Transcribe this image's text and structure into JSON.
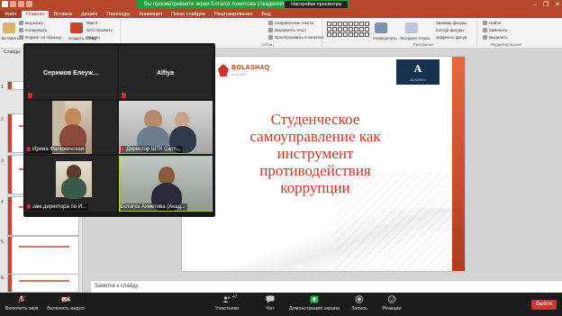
{
  "titlebar": {
    "zoom_banner": "Вы просматриваете экран Ботагоз Ахметова (Академия \"Bo...",
    "view_options": "Настройки просмотра",
    "minimize": "–",
    "maximize": "❐",
    "close": "✕"
  },
  "ribbon": {
    "tabs": [
      "Файл",
      "Главная",
      "Вставка",
      "Дизайн",
      "Переходы",
      "Анимация",
      "Показ слайдов",
      "Рецензирование",
      "Вид"
    ],
    "clipboard": {
      "cut": "Вырезать",
      "copy": "Копировать",
      "format": "Формат по образцу",
      "paste": "Вставить"
    },
    "slides": {
      "create": "Создать слайд",
      "layout": "Макет",
      "reset": "Восстановить",
      "section": "Раздел"
    },
    "paragraph": {
      "text_direction": "Направление текста",
      "align_text": "Выровнять текст",
      "smartart": "Преобразовать в SmartArt",
      "group_label": "Абзац"
    },
    "drawing": {
      "arrange": "Упорядочить",
      "quick_styles": "Экспресс-стили",
      "fill": "Заливка фигуры",
      "outline": "Контур фигуры",
      "effects": "Эффекты фигур",
      "group_label": "Рисование"
    },
    "editing": {
      "find": "Найти",
      "replace": "Заменить",
      "select": "Выделить",
      "group_label": "Редактирование"
    }
  },
  "slide_panel": {
    "header": "Слайды",
    "numbers": [
      "1",
      "2",
      "3",
      "4",
      "5",
      "6"
    ]
  },
  "slide": {
    "logo_left_name": "BOLASHAQ",
    "logo_left_sub": "ACADEMY",
    "logo_right_letter": "A",
    "logo_right_sub": "ACADEMY",
    "title": "Студенческое самоуправление как инструмент противодействия коррупции"
  },
  "notes": {
    "placeholder": "Заметки к слайду"
  },
  "gallery": {
    "tiles": [
      {
        "name": "Серимов  Елеуж..."
      },
      {
        "name": "Alfiya"
      },
      {
        "label": "Ирина Фалежинская"
      },
      {
        "label": "Директор ШТК Сатп..."
      },
      {
        "label": "зам.директора по И..."
      },
      {
        "label": "Ботагоз Ахметова (Акад..."
      }
    ]
  },
  "zoombar": {
    "unmute": "Включить звук",
    "start_video": "Включить видео",
    "participants": "Участники",
    "participants_count": "47",
    "chat": "Чат",
    "share_screen": "Демонстрация экрана",
    "record": "Запись",
    "reactions": "Реакции",
    "leave": "Выйти"
  },
  "colors": {
    "powerpoint_red": "#b7472a",
    "zoom_green": "#1f9e3a",
    "leave_red": "#d7342b",
    "slide_title": "#c0392b"
  }
}
